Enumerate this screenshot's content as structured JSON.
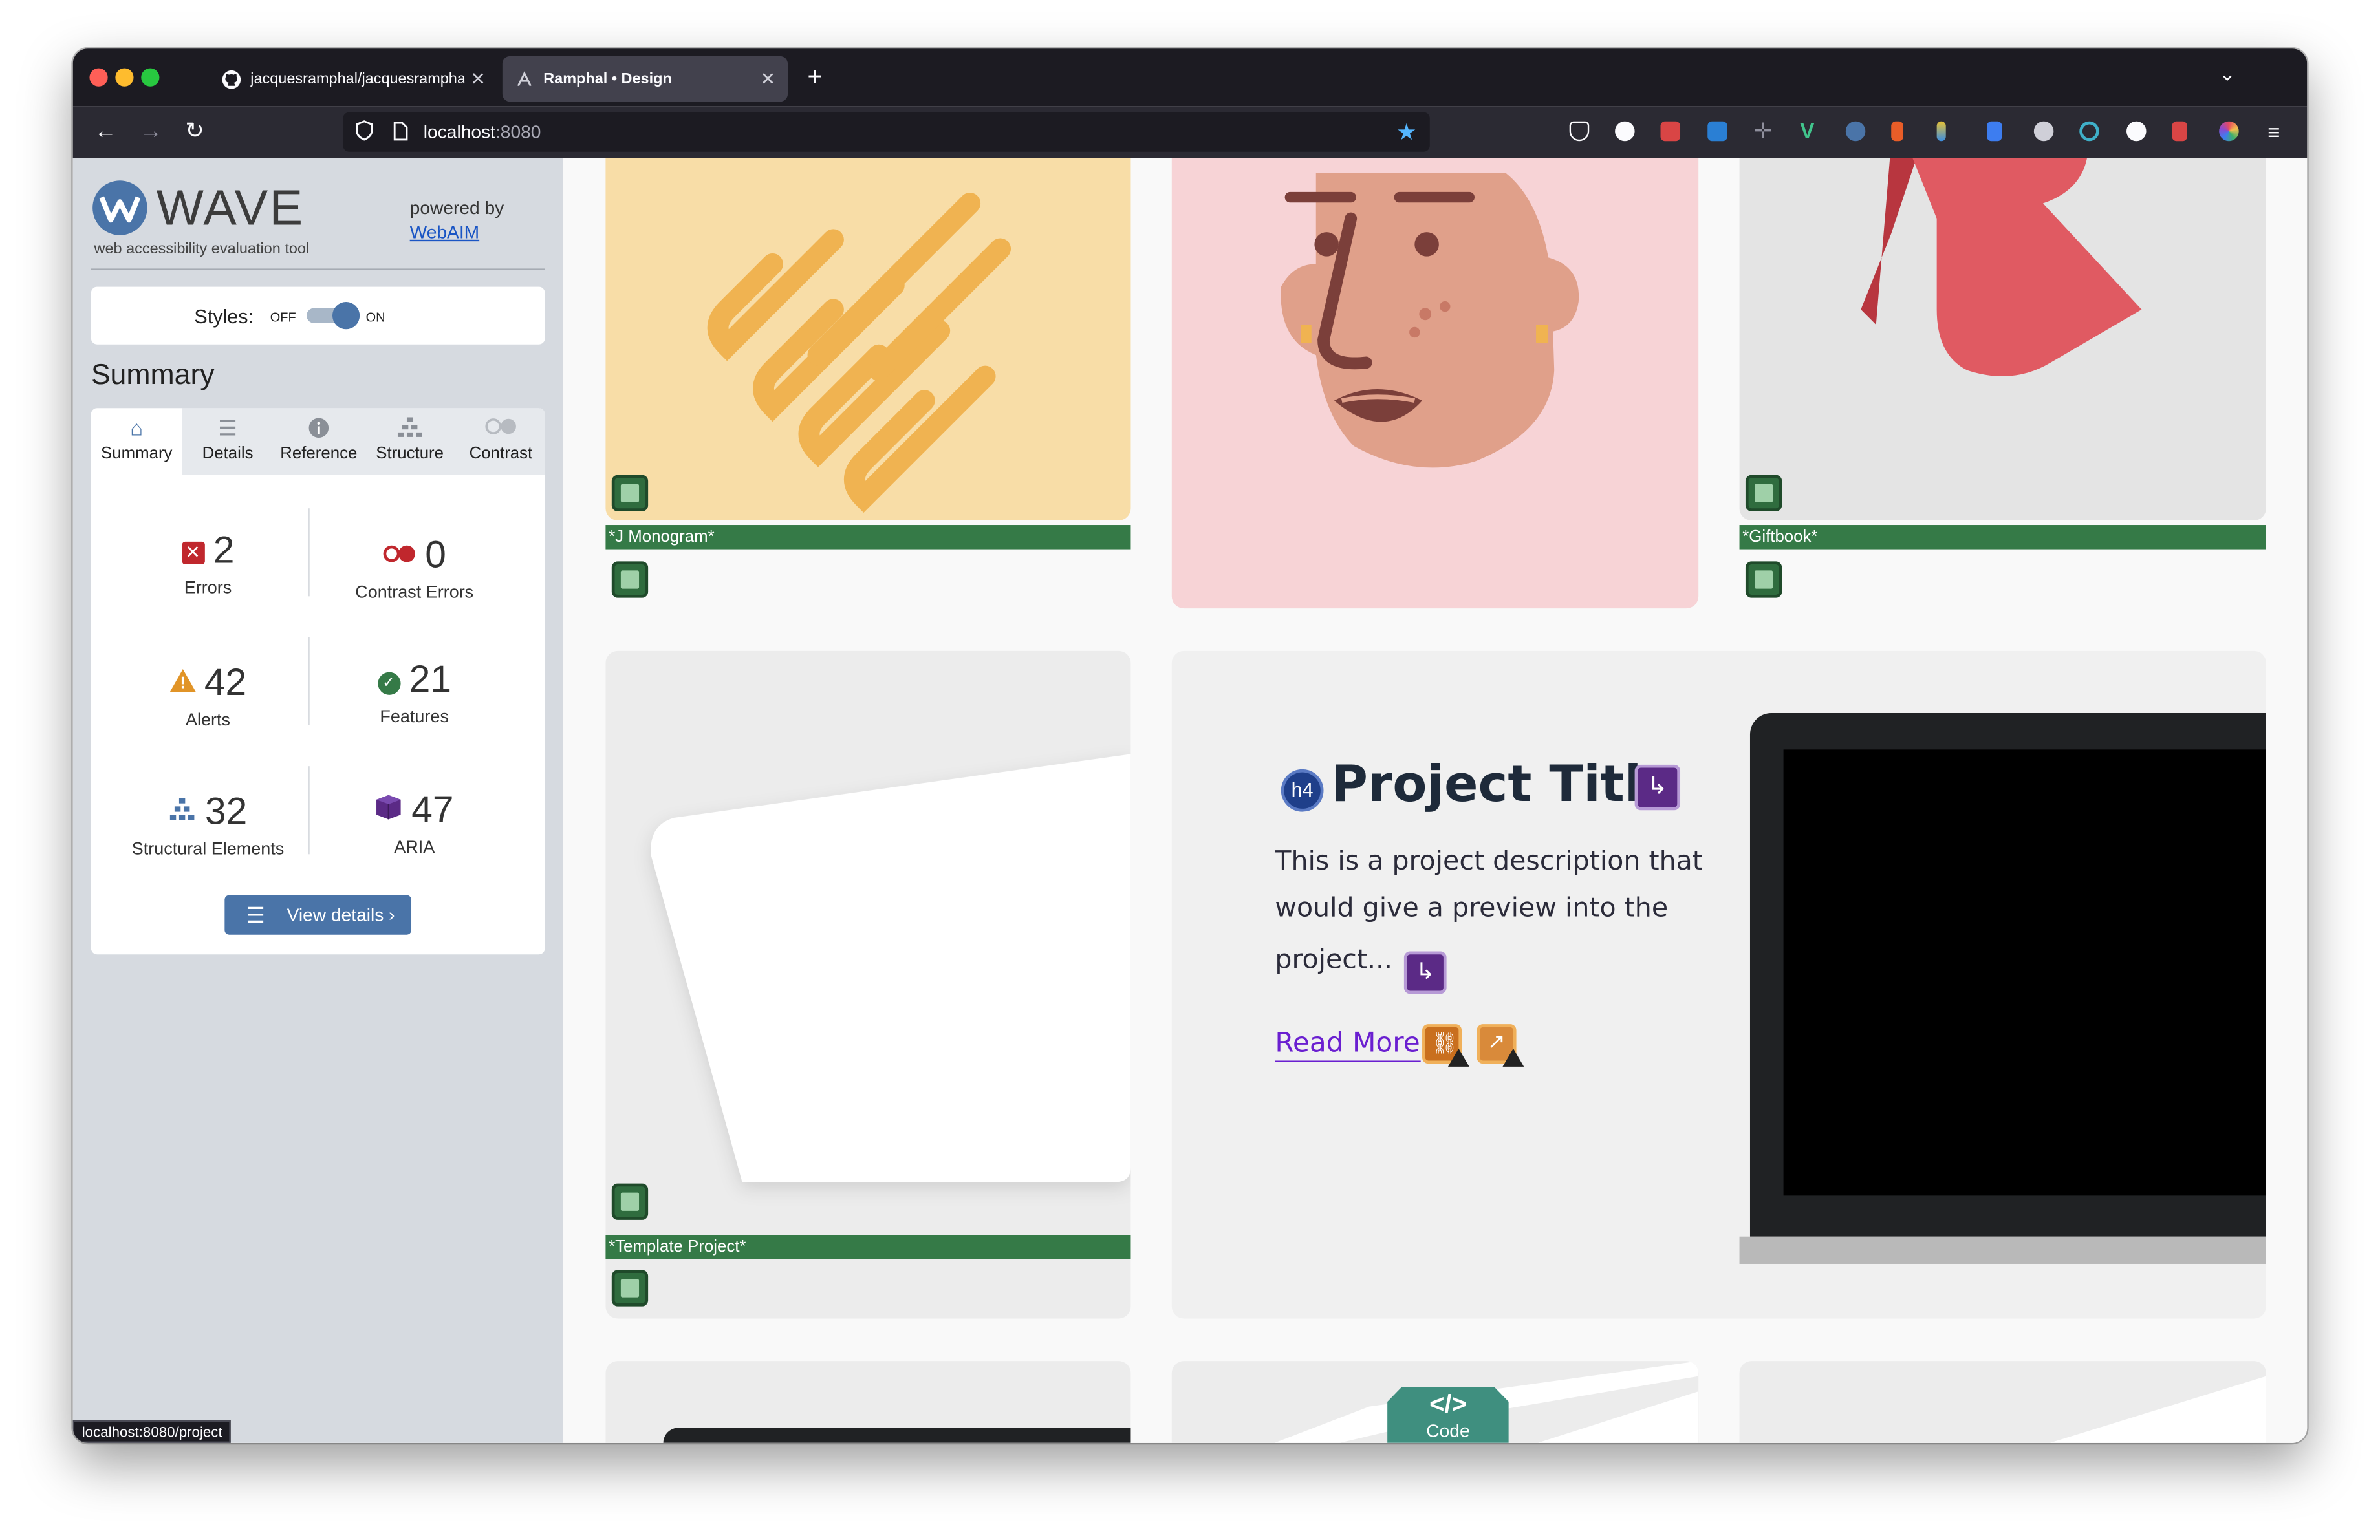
{
  "browser": {
    "tabs": [
      {
        "title": "jacquesramphal/jacquesramphal",
        "icon": "github-icon"
      },
      {
        "title": "Ramphal • Design",
        "icon": "ramphal-logo-icon"
      }
    ],
    "url_host": "localhost",
    "url_port": ":8080",
    "status_url": "localhost:8080/project"
  },
  "wave": {
    "logo_text": "WAVE",
    "tagline": "web accessibility evaluation tool",
    "powered_by": "powered by",
    "powered_link": "WebAIM",
    "styles_label": "Styles:",
    "styles_off": "OFF",
    "styles_on": "ON",
    "summary_heading": "Summary",
    "tabs": [
      {
        "label": "Summary",
        "icon": "home-icon"
      },
      {
        "label": "Details",
        "icon": "list-icon"
      },
      {
        "label": "Reference",
        "icon": "info-icon"
      },
      {
        "label": "Structure",
        "icon": "hierarchy-icon"
      },
      {
        "label": "Contrast",
        "icon": "contrast-icon"
      }
    ],
    "stats": {
      "errors": {
        "count": "2",
        "label": "Errors"
      },
      "contrast": {
        "count": "0",
        "label": "Contrast Errors"
      },
      "alerts": {
        "count": "42",
        "label": "Alerts"
      },
      "features": {
        "count": "21",
        "label": "Features"
      },
      "structure": {
        "count": "32",
        "label": "Structural Elements"
      },
      "aria": {
        "count": "47",
        "label": "ARIA"
      }
    },
    "view_details": "View details ›"
  },
  "page": {
    "alt_labels": [
      "*J Monogram*",
      "*Giftbook*",
      "*Template Project*"
    ],
    "heading_badge": "h4",
    "project_title": "Project Title",
    "project_desc_1": "This is a project description that",
    "project_desc_2": "would give a preview into the",
    "project_desc_3": "project...",
    "read_more": "Read More",
    "code_badge_symbol": "</>",
    "code_badge_label": "Code"
  },
  "colors": {
    "browser_chrome": "#1c1b22",
    "sidebar_bg": "#d6dae0",
    "wave_blue": "#4a74a8",
    "feature_green": "#357a47",
    "aria_purple": "#5b2a86",
    "link_purple": "#6a1fd0",
    "monogram_bg": "#f8dda7",
    "portrait_bg": "#f7d3d6"
  }
}
